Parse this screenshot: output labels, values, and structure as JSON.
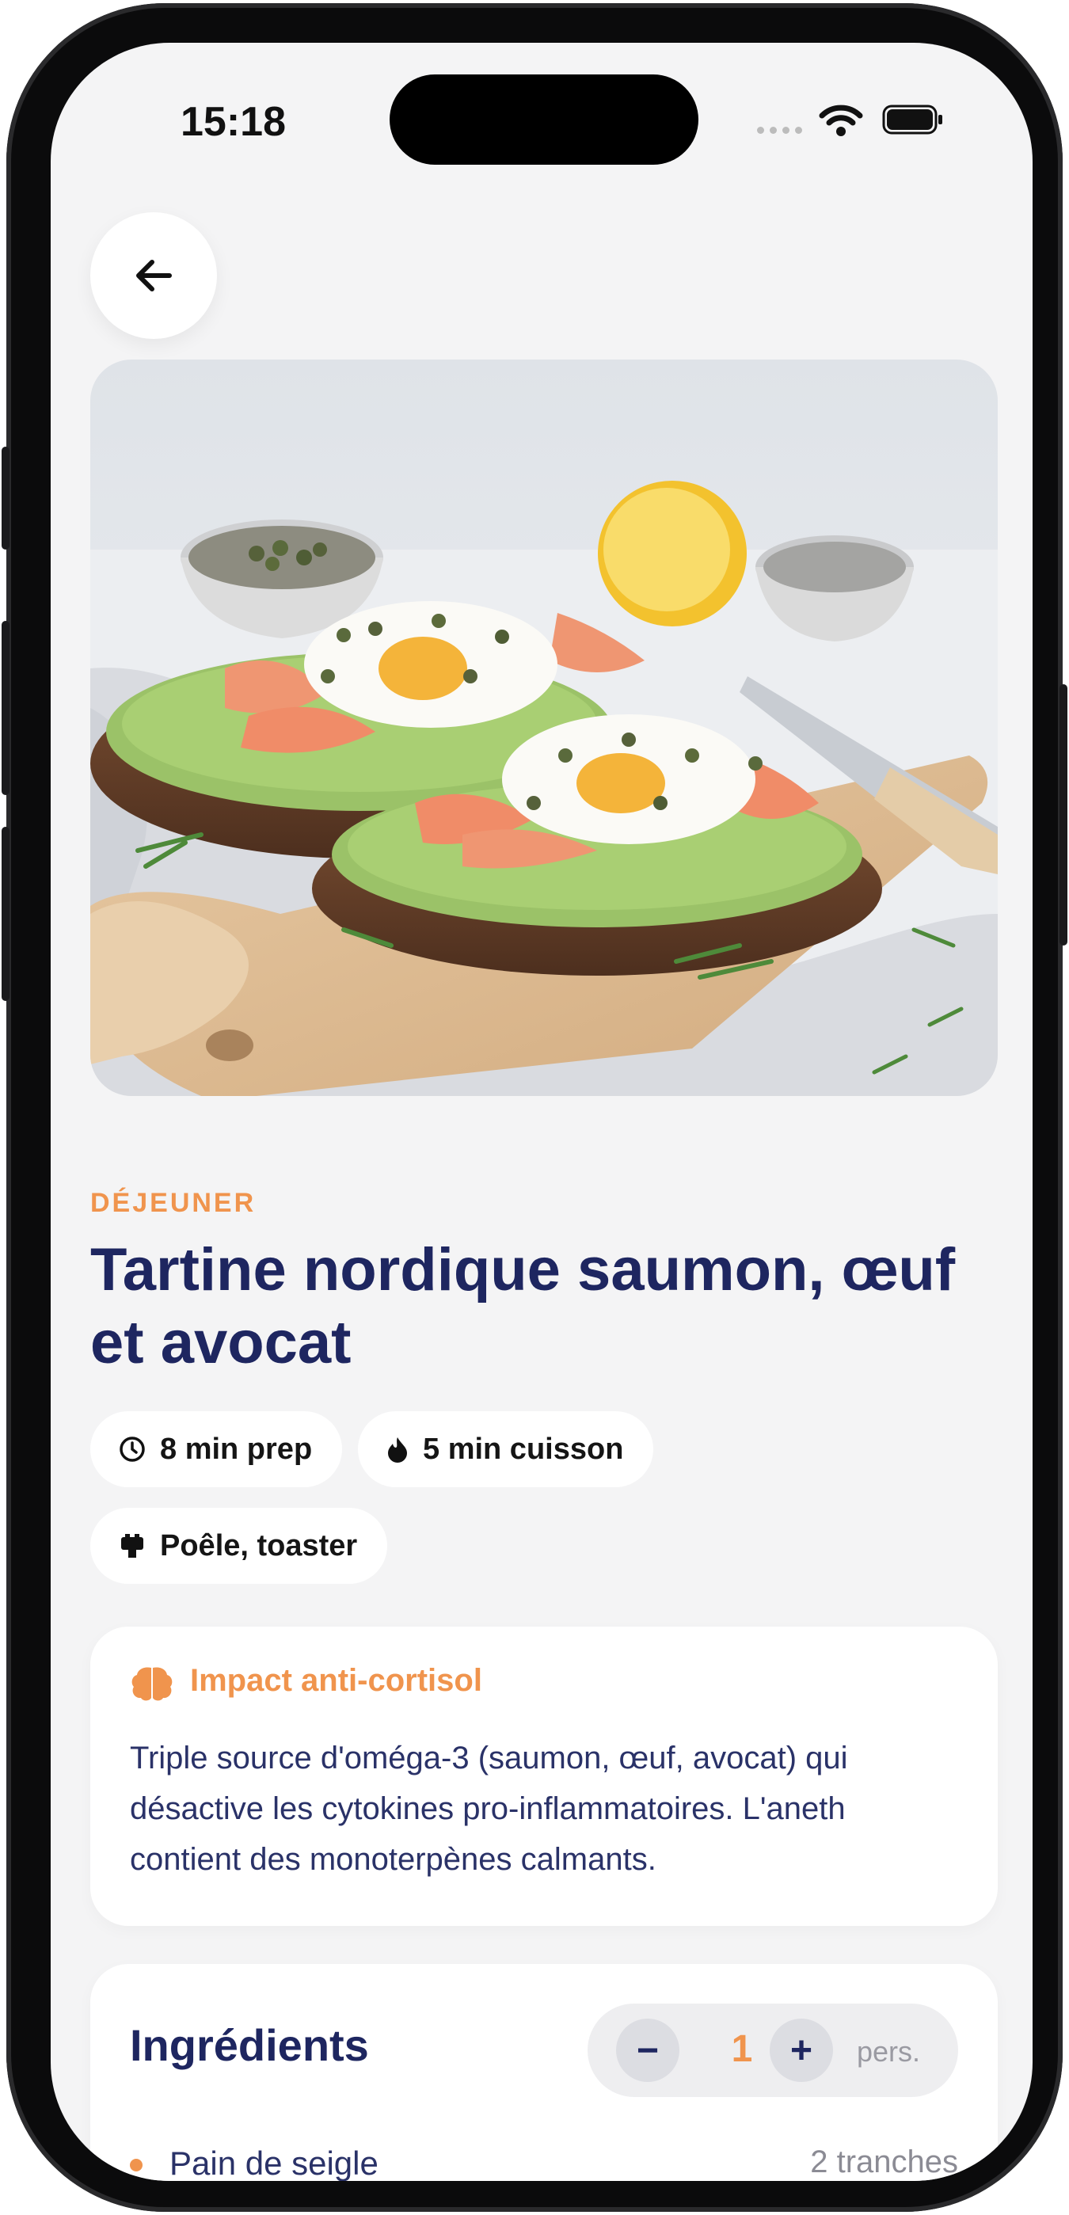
{
  "colors": {
    "accent": "#f0944d",
    "navy": "#1e2660",
    "background": "#f4f4f5"
  },
  "status_bar": {
    "time": "15:18"
  },
  "back": {
    "icon": "arrow-left-icon"
  },
  "recipe": {
    "category": "DÉJEUNER",
    "title": "Tartine nordique saumon, œuf et avocat",
    "chips": [
      {
        "icon": "clock-icon",
        "label": "8 min prep"
      },
      {
        "icon": "flame-icon",
        "label": "5 min cuisson"
      },
      {
        "icon": "toaster-icon",
        "label": "Poêle, toaster"
      }
    ]
  },
  "impact": {
    "icon": "brain-icon",
    "title": "Impact anti-cortisol",
    "text": "Triple source d'oméga-3 (saumon, œuf, avocat) qui désactive les cytokines pro-inflammatoires. L'aneth contient des monoterpènes calmants."
  },
  "ingredients": {
    "title": "Ingrédients",
    "servings": {
      "minus": "−",
      "value": "1",
      "plus": "+",
      "unit": "pers."
    },
    "items": [
      {
        "name": "Pain de seigle",
        "quantity": "2 tranches"
      }
    ]
  }
}
